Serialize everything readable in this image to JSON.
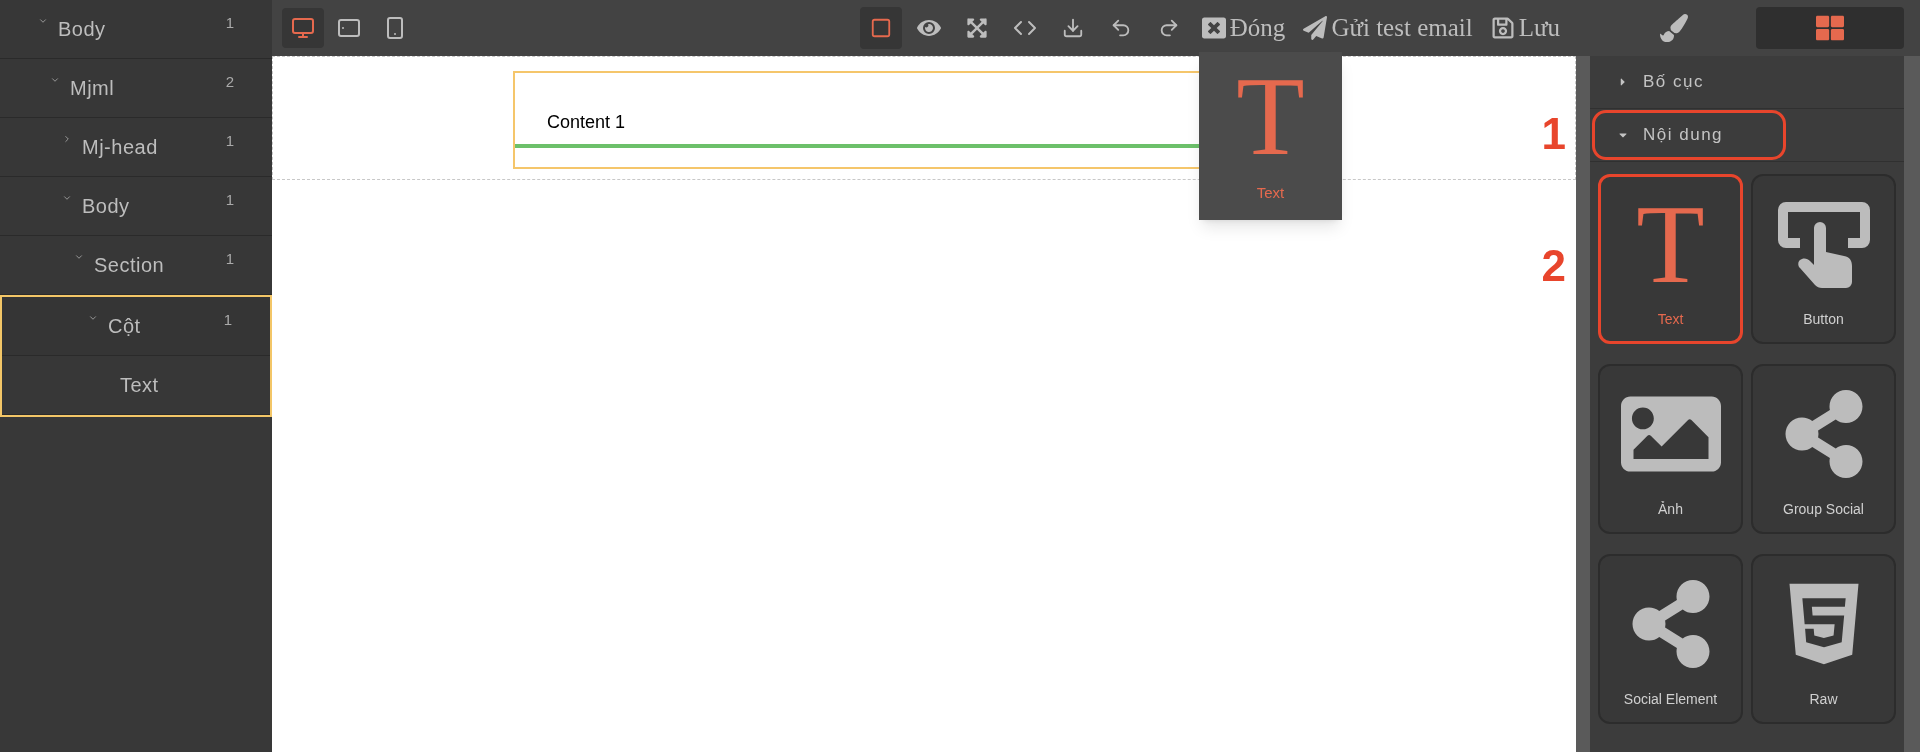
{
  "layers": [
    {
      "name": "Body",
      "count": "1",
      "expanded": true,
      "selected": false,
      "children": [
        {
          "name": "Mjml",
          "count": "2",
          "expanded": true,
          "selected": false,
          "children": [
            {
              "name": "Mj-head",
              "count": "1",
              "expanded": false,
              "selected": false
            },
            {
              "name": "Body",
              "count": "1",
              "expanded": true,
              "selected": false,
              "children": [
                {
                  "name": "Section",
                  "count": "1",
                  "expanded": true,
                  "selected": false,
                  "children": [
                    {
                      "name": "Cột",
                      "count": "1",
                      "expanded": true,
                      "selected": true,
                      "children": [
                        {
                          "name": "Text",
                          "selected": false
                        }
                      ]
                    }
                  ]
                }
              ]
            }
          ]
        }
      ]
    }
  ],
  "toolbar": {
    "devices": [
      {
        "kind": "desktop",
        "selected": true
      },
      {
        "kind": "tablet",
        "selected": false
      },
      {
        "kind": "mobile",
        "selected": false
      }
    ],
    "tools": [
      {
        "kind": "outline",
        "active": true
      },
      {
        "kind": "preview",
        "active": false
      },
      {
        "kind": "fullscreen",
        "active": false
      },
      {
        "kind": "code",
        "active": false
      },
      {
        "kind": "download",
        "active": false
      },
      {
        "kind": "undo",
        "active": false
      },
      {
        "kind": "redo",
        "active": false
      }
    ],
    "actions": [
      {
        "kind": "close",
        "label": "Đóng"
      },
      {
        "kind": "send",
        "label": "Gửi test email"
      },
      {
        "kind": "save",
        "label": "Lưu"
      }
    ]
  },
  "canvas": {
    "content": "Content 1",
    "drag_preview": {
      "glyph": "T",
      "label": "Text"
    }
  },
  "panel": {
    "tabs": [
      {
        "kind": "style",
        "selected": false
      },
      {
        "kind": "blocks",
        "selected": true
      }
    ],
    "categories": [
      {
        "label": "Bố cục",
        "expanded": false,
        "highlighted": false
      },
      {
        "label": "Nội dung",
        "expanded": true,
        "highlighted": true
      }
    ],
    "blocks": [
      {
        "kind": "text",
        "label": "Text",
        "glyph": "T",
        "active": true,
        "highlighted": true
      },
      {
        "kind": "button",
        "label": "Button",
        "active": false,
        "highlighted": false
      },
      {
        "kind": "image",
        "label": "Ảnh",
        "active": false,
        "highlighted": false
      },
      {
        "kind": "share",
        "label": "Group Social",
        "active": false,
        "highlighted": false
      },
      {
        "kind": "share",
        "label": "Social Element",
        "active": false,
        "highlighted": false
      },
      {
        "kind": "html",
        "label": "Raw",
        "active": false,
        "highlighted": false
      }
    ]
  },
  "annotations": [
    {
      "label": "1"
    },
    {
      "label": "2"
    }
  ]
}
